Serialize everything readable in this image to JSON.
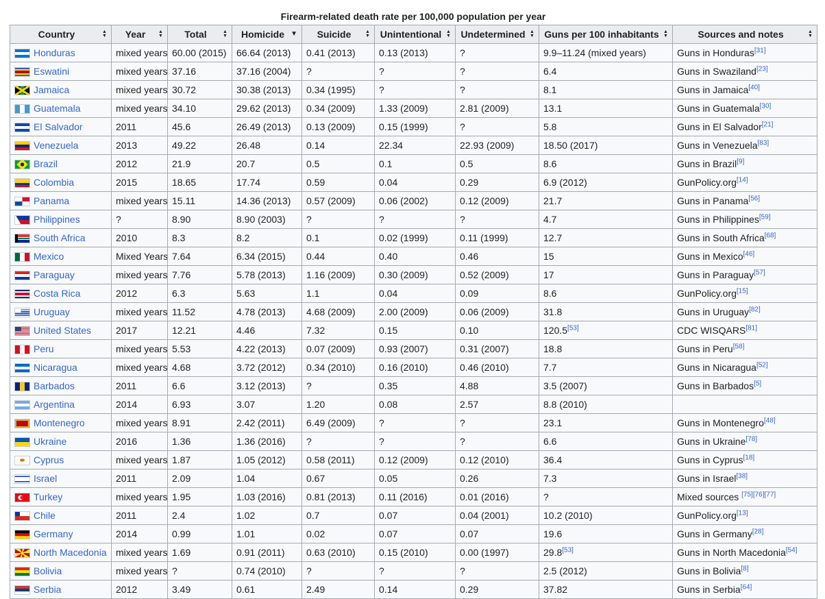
{
  "caption": "Firearm-related death rate per 100,000 population per year",
  "columns": [
    {
      "label": "Country",
      "sort_icon": "sort-arrows-icon"
    },
    {
      "label": "Year",
      "sort_icon": "sort-arrows-icon"
    },
    {
      "label": "Total",
      "sort_icon": "sort-arrows-icon"
    },
    {
      "label": "Homicide",
      "sort_icon": "sort-descending-icon"
    },
    {
      "label": "Suicide",
      "sort_icon": "sort-arrows-icon"
    },
    {
      "label": "Unintentional",
      "sort_icon": "sort-arrows-icon"
    },
    {
      "label": "Undetermined",
      "sort_icon": "sort-arrows-icon"
    },
    {
      "label": "Guns per 100 inhabitants",
      "sort_icon": "sort-arrows-icon"
    },
    {
      "label": "Sources and notes",
      "sort_icon": "sort-arrows-icon"
    }
  ],
  "rows": [
    {
      "country": "Honduras",
      "flag": "honduras-flag",
      "year": "mixed years",
      "total": "60.00 (2015)",
      "homicide": "66.64 (2013)",
      "suicide": "0.41 (2013)",
      "unintentional": "0.13 (2013)",
      "undetermined": "?",
      "guns": "9.9–11.24 (mixed years)",
      "guns_ref": "",
      "source": "Guns in Honduras",
      "source_ref": "[31]"
    },
    {
      "country": "Eswatini",
      "flag": "eswatini-flag",
      "year": "mixed years",
      "total": "37.16",
      "homicide": "37.16 (2004)",
      "suicide": "?",
      "unintentional": "?",
      "undetermined": "?",
      "guns": "6.4",
      "guns_ref": "",
      "source": "Guns in Swaziland",
      "source_ref": "[23]"
    },
    {
      "country": "Jamaica",
      "flag": "jamaica-flag",
      "year": "mixed years",
      "total": "30.72",
      "homicide": "30.38 (2013)",
      "suicide": "0.34 (1995)",
      "unintentional": "?",
      "undetermined": "?",
      "guns": "8.1",
      "guns_ref": "",
      "source": "Guns in Jamaica",
      "source_ref": "[40]"
    },
    {
      "country": "Guatemala",
      "flag": "guatemala-flag",
      "year": "mixed years",
      "total": "34.10",
      "homicide": "29.62 (2013)",
      "suicide": "0.34 (2009)",
      "unintentional": "1.33 (2009)",
      "undetermined": "2.81 (2009)",
      "guns": "13.1",
      "guns_ref": "",
      "source": "Guns in Guatemala",
      "source_ref": "[30]"
    },
    {
      "country": "El Salvador",
      "flag": "el-salvador-flag",
      "year": "2011",
      "total": "45.6",
      "homicide": "26.49 (2013)",
      "suicide": "0.13 (2009)",
      "unintentional": "0.15 (1999)",
      "undetermined": "?",
      "guns": "5.8",
      "guns_ref": "",
      "source": "Guns in El Salvador",
      "source_ref": "[21]"
    },
    {
      "country": "Venezuela",
      "flag": "venezuela-flag",
      "year": "2013",
      "total": "49.22",
      "homicide": "26.48",
      "suicide": "0.14",
      "unintentional": "22.34",
      "undetermined": "22.93 (2009)",
      "guns": "18.50 (2017)",
      "guns_ref": "",
      "source": "Guns in Venezuela",
      "source_ref": "[83]"
    },
    {
      "country": "Brazil",
      "flag": "brazil-flag",
      "year": "2012",
      "total": "21.9",
      "homicide": "20.7",
      "suicide": "0.5",
      "unintentional": "0.1",
      "undetermined": "0.5",
      "guns": "8.6",
      "guns_ref": "",
      "source": "Guns in Brazil",
      "source_ref": "[9]"
    },
    {
      "country": "Colombia",
      "flag": "colombia-flag",
      "year": "2015",
      "total": "18.65",
      "homicide": "17.74",
      "suicide": "0.59",
      "unintentional": "0.04",
      "undetermined": "0.29",
      "guns": "6.9 (2012)",
      "guns_ref": "",
      "source": "GunPolicy.org",
      "source_ref": "[14]"
    },
    {
      "country": "Panama",
      "flag": "panama-flag",
      "year": "mixed years",
      "total": "15.11",
      "homicide": "14.36 (2013)",
      "suicide": "0.57 (2009)",
      "unintentional": "0.06 (2002)",
      "undetermined": "0.12 (2009)",
      "guns": "21.7",
      "guns_ref": "",
      "source": "Guns in Panama",
      "source_ref": "[56]"
    },
    {
      "country": "Philippines",
      "flag": "philippines-flag",
      "year": "?",
      "total": "8.90",
      "homicide": "8.90 (2003)",
      "suicide": "?",
      "unintentional": "?",
      "undetermined": "?",
      "guns": "4.7",
      "guns_ref": "",
      "source": "Guns in Philippines",
      "source_ref": "[59]"
    },
    {
      "country": "South Africa",
      "flag": "south-africa-flag",
      "year": "2010",
      "total": "8.3",
      "homicide": "8.2",
      "suicide": "0.1",
      "unintentional": "0.02 (1999)",
      "undetermined": "0.11 (1999)",
      "guns": "12.7",
      "guns_ref": "",
      "source": "Guns in South Africa",
      "source_ref": "[68]"
    },
    {
      "country": "Mexico",
      "flag": "mexico-flag",
      "year": "Mixed Years",
      "total": "7.64",
      "homicide": "6.34 (2015)",
      "suicide": "0.44",
      "unintentional": "0.40",
      "undetermined": "0.46",
      "guns": "15",
      "guns_ref": "",
      "source": "Guns in Mexico",
      "source_ref": "[46]"
    },
    {
      "country": "Paraguay",
      "flag": "paraguay-flag",
      "year": "mixed years",
      "total": "7.76",
      "homicide": "5.78 (2013)",
      "suicide": "1.16 (2009)",
      "unintentional": "0.30 (2009)",
      "undetermined": "0.52 (2009)",
      "guns": "17",
      "guns_ref": "",
      "source": "Guns in Paraguay",
      "source_ref": "[57]"
    },
    {
      "country": "Costa Rica",
      "flag": "costa-rica-flag",
      "year": "2012",
      "total": "6.3",
      "homicide": "5.63",
      "suicide": "1.1",
      "unintentional": "0.04",
      "undetermined": "0.09",
      "guns": "8.6",
      "guns_ref": "",
      "source": "GunPolicy.org",
      "source_ref": "[15]"
    },
    {
      "country": "Uruguay",
      "flag": "uruguay-flag",
      "year": "mixed years",
      "total": "11.52",
      "homicide": "4.78 (2013)",
      "suicide": "4.68 (2009)",
      "unintentional": "2.00 (2009)",
      "undetermined": "0.06 (2009)",
      "guns": "31.8",
      "guns_ref": "",
      "source": "Guns in Uruguay",
      "source_ref": "[82]"
    },
    {
      "country": "United States",
      "flag": "united-states-flag",
      "year": "2017",
      "total": "12.21",
      "homicide": "4.46",
      "suicide": "7.32",
      "unintentional": "0.15",
      "undetermined": "0.10",
      "guns": "120.5",
      "guns_ref": "[53]",
      "source": "CDC WISQARS",
      "source_ref": "[81]"
    },
    {
      "country": "Peru",
      "flag": "peru-flag",
      "year": "mixed years",
      "total": "5.53",
      "homicide": "4.22 (2013)",
      "suicide": "0.07 (2009)",
      "unintentional": "0.93 (2007)",
      "undetermined": "0.31 (2007)",
      "guns": "18.8",
      "guns_ref": "",
      "source": "Guns in Peru",
      "source_ref": "[58]"
    },
    {
      "country": "Nicaragua",
      "flag": "nicaragua-flag",
      "year": "mixed years",
      "total": "4.68",
      "homicide": "3.72 (2012)",
      "suicide": "0.34 (2010)",
      "unintentional": "0.16 (2010)",
      "undetermined": "0.46 (2010)",
      "guns": "7.7",
      "guns_ref": "",
      "source": "Guns in Nicaragua",
      "source_ref": "[52]"
    },
    {
      "country": "Barbados",
      "flag": "barbados-flag",
      "year": "2011",
      "total": "6.6",
      "homicide": "3.12 (2013)",
      "suicide": "?",
      "unintentional": "0.35",
      "undetermined": "4.88",
      "guns": "3.5 (2007)",
      "guns_ref": "",
      "source": "Guns in Barbados",
      "source_ref": "[5]"
    },
    {
      "country": "Argentina",
      "flag": "argentina-flag",
      "year": "2014",
      "total": "6.93",
      "homicide": "3.07",
      "suicide": "1.20",
      "unintentional": "0.08",
      "undetermined": "2.57",
      "guns": "8.8 (2010)",
      "guns_ref": "",
      "source": "",
      "source_ref": ""
    },
    {
      "country": "Montenegro",
      "flag": "montenegro-flag",
      "year": "mixed years",
      "total": "8.91",
      "homicide": "2.42 (2011)",
      "suicide": "6.49 (2009)",
      "unintentional": "?",
      "undetermined": "?",
      "guns": "23.1",
      "guns_ref": "",
      "source": "Guns in Montenegro",
      "source_ref": "[48]"
    },
    {
      "country": "Ukraine",
      "flag": "ukraine-flag",
      "year": "2016",
      "total": "1.36",
      "homicide": "1.36 (2016)",
      "suicide": "?",
      "unintentional": "?",
      "undetermined": "?",
      "guns": "6.6",
      "guns_ref": "",
      "source": "Guns in Ukraine",
      "source_ref": "[78]"
    },
    {
      "country": "Cyprus",
      "flag": "cyprus-flag",
      "year": "mixed years",
      "total": "1.87",
      "homicide": "1.05 (2012)",
      "suicide": "0.58 (2011)",
      "unintentional": "0.12 (2009)",
      "undetermined": "0.12 (2010)",
      "guns": "36.4",
      "guns_ref": "",
      "source": "Guns in Cyprus",
      "source_ref": "[18]"
    },
    {
      "country": "Israel",
      "flag": "israel-flag",
      "year": "2011",
      "total": "2.09",
      "homicide": "1.04",
      "suicide": "0.67",
      "unintentional": "0.05",
      "undetermined": "0.26",
      "guns": "7.3",
      "guns_ref": "",
      "source": "Guns in Israel",
      "source_ref": "[38]"
    },
    {
      "country": "Turkey",
      "flag": "turkey-flag",
      "year": "mixed years",
      "total": "1.95",
      "homicide": "1.03 (2016)",
      "suicide": "0.81 (2013)",
      "unintentional": "0.11 (2016)",
      "undetermined": "0.01 (2016)",
      "guns": "?",
      "guns_ref": "",
      "source": "Mixed sources ",
      "source_ref": "[75][76][77]"
    },
    {
      "country": "Chile",
      "flag": "chile-flag",
      "year": "2011",
      "total": "2.4",
      "homicide": "1.02",
      "suicide": "0.7",
      "unintentional": "0.07",
      "undetermined": "0.04 (2001)",
      "guns": "10.2 (2010)",
      "guns_ref": "",
      "source": "GunPolicy.org",
      "source_ref": "[13]"
    },
    {
      "country": "Germany",
      "flag": "germany-flag",
      "year": "2014",
      "total": "0.99",
      "homicide": "1.01",
      "suicide": "0.02",
      "unintentional": "0.07",
      "undetermined": "0.07",
      "guns": "19.6",
      "guns_ref": "",
      "source": "Guns in Germany",
      "source_ref": "[28]"
    },
    {
      "country": "North Macedonia",
      "flag": "north-macedonia-flag",
      "year": "mixed years",
      "total": "1.69",
      "homicide": "0.91 (2011)",
      "suicide": "0.63 (2010)",
      "unintentional": "0.15 (2010)",
      "undetermined": "0.00 (1997)",
      "guns": "29.8",
      "guns_ref": "[53]",
      "source": "Guns in North Macedonia",
      "source_ref": "[54]"
    },
    {
      "country": "Bolivia",
      "flag": "bolivia-flag",
      "year": "mixed years",
      "total": "?",
      "homicide": "0.74 (2010)",
      "suicide": "?",
      "unintentional": "?",
      "undetermined": "?",
      "guns": "2.5 (2012)",
      "guns_ref": "",
      "source": "Guns in Bolivia",
      "source_ref": "[8]"
    },
    {
      "country": "Serbia",
      "flag": "serbia-flag",
      "year": "2012",
      "total": "3.49",
      "homicide": "0.61",
      "suicide": "2.49",
      "unintentional": "0.14",
      "undetermined": "0.29",
      "guns": "37.82",
      "guns_ref": "",
      "source": "Guns in Serbia",
      "source_ref": "[64]"
    }
  ],
  "colors": {
    "link": "#3366cc",
    "header_bg": "#eaecf0",
    "cell_bg": "#f8f9fa",
    "border": "#a2a9b1",
    "text": "#202122"
  }
}
